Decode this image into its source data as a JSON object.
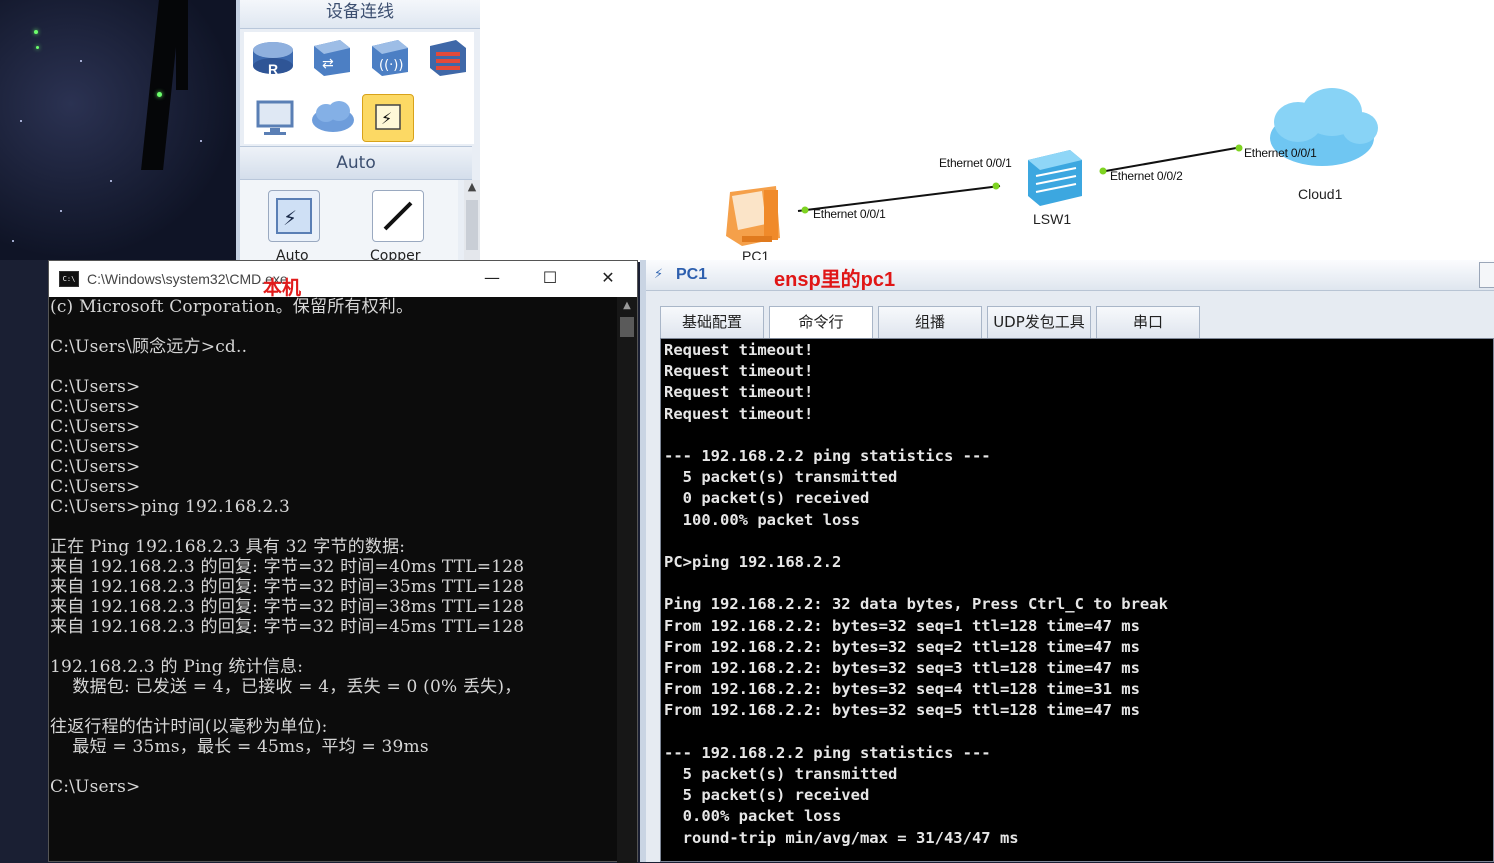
{
  "device_panel": {
    "category_title": "设备连线",
    "auto_label": "Auto",
    "icons": [
      "router-icon",
      "switch-icon",
      "wireless-icon",
      "firewall-icon",
      "pc-icon",
      "cloud-icon",
      "connection-icon"
    ],
    "sub_items": [
      {
        "icon": "auto-connect-icon",
        "label": "Auto"
      },
      {
        "icon": "copper-cable-icon",
        "label": "Copper"
      }
    ]
  },
  "topology": {
    "nodes": {
      "pc1": "PC1",
      "lsw1": "LSW1",
      "cloud1": "Cloud1"
    },
    "ports": {
      "pc1_eth": "Ethernet 0/0/1",
      "lsw1_eth1": "Ethernet 0/0/1",
      "lsw1_eth2": "Ethernet 0/0/2",
      "cloud1_eth": "Ethernet 0/0/1"
    }
  },
  "cmd_window": {
    "title": "C:\\Windows\\system32\\CMD.exe",
    "annotation": "本机",
    "minimize": "—",
    "maximize": "☐",
    "close": "✕",
    "lines": [
      "(c) Microsoft Corporation。保留所有权利。",
      "",
      "C:\\Users\\顾念远方>cd..",
      "",
      "C:\\Users>",
      "C:\\Users>",
      "C:\\Users>",
      "C:\\Users>",
      "C:\\Users>",
      "C:\\Users>",
      "C:\\Users>ping 192.168.2.3",
      "",
      "正在 Ping 192.168.2.3 具有 32 字节的数据:",
      "来自 192.168.2.3 的回复: 字节=32 时间=40ms TTL=128",
      "来自 192.168.2.3 的回复: 字节=32 时间=35ms TTL=128",
      "来自 192.168.2.3 的回复: 字节=32 时间=38ms TTL=128",
      "来自 192.168.2.3 的回复: 字节=32 时间=45ms TTL=128",
      "",
      "192.168.2.3 的 Ping 统计信息:",
      "    数据包: 已发送 = 4，已接收 = 4，丢失 = 0 (0% 丢失)，",
      "",
      "往返行程的估计时间(以毫秒为单位):",
      "    最短 = 35ms，最长 = 45ms，平均 = 39ms",
      "",
      "C:\\Users>"
    ]
  },
  "pc1_window": {
    "title": "PC1",
    "annotation": "ensp里的pc1",
    "tabs": [
      "基础配置",
      "命令行",
      "组播",
      "UDP发包工具",
      "串口"
    ],
    "active_tab": "命令行",
    "lines": [
      "Request timeout!",
      "Request timeout!",
      "Request timeout!",
      "Request timeout!",
      "",
      "--- 192.168.2.2 ping statistics ---",
      "  5 packet(s) transmitted",
      "  0 packet(s) received",
      "  100.00% packet loss",
      "",
      "PC>ping 192.168.2.2",
      "",
      "Ping 192.168.2.2: 32 data bytes, Press Ctrl_C to break",
      "From 192.168.2.2: bytes=32 seq=1 ttl=128 time=47 ms",
      "From 192.168.2.2: bytes=32 seq=2 ttl=128 time=47 ms",
      "From 192.168.2.2: bytes=32 seq=3 ttl=128 time=47 ms",
      "From 192.168.2.2: bytes=32 seq=4 ttl=128 time=31 ms",
      "From 192.168.2.2: bytes=32 seq=5 ttl=128 time=47 ms",
      "",
      "--- 192.168.2.2 ping statistics ---",
      "  5 packet(s) transmitted",
      "  5 packet(s) received",
      "  0.00% packet loss",
      "  round-trip min/avg/max = 31/43/47 ms"
    ]
  },
  "colors": {
    "annotation_red": "#e01616",
    "link_dot_green": "#7ed321",
    "cmd_bg": "#0c0c0c",
    "terminal_bg": "#000000"
  }
}
